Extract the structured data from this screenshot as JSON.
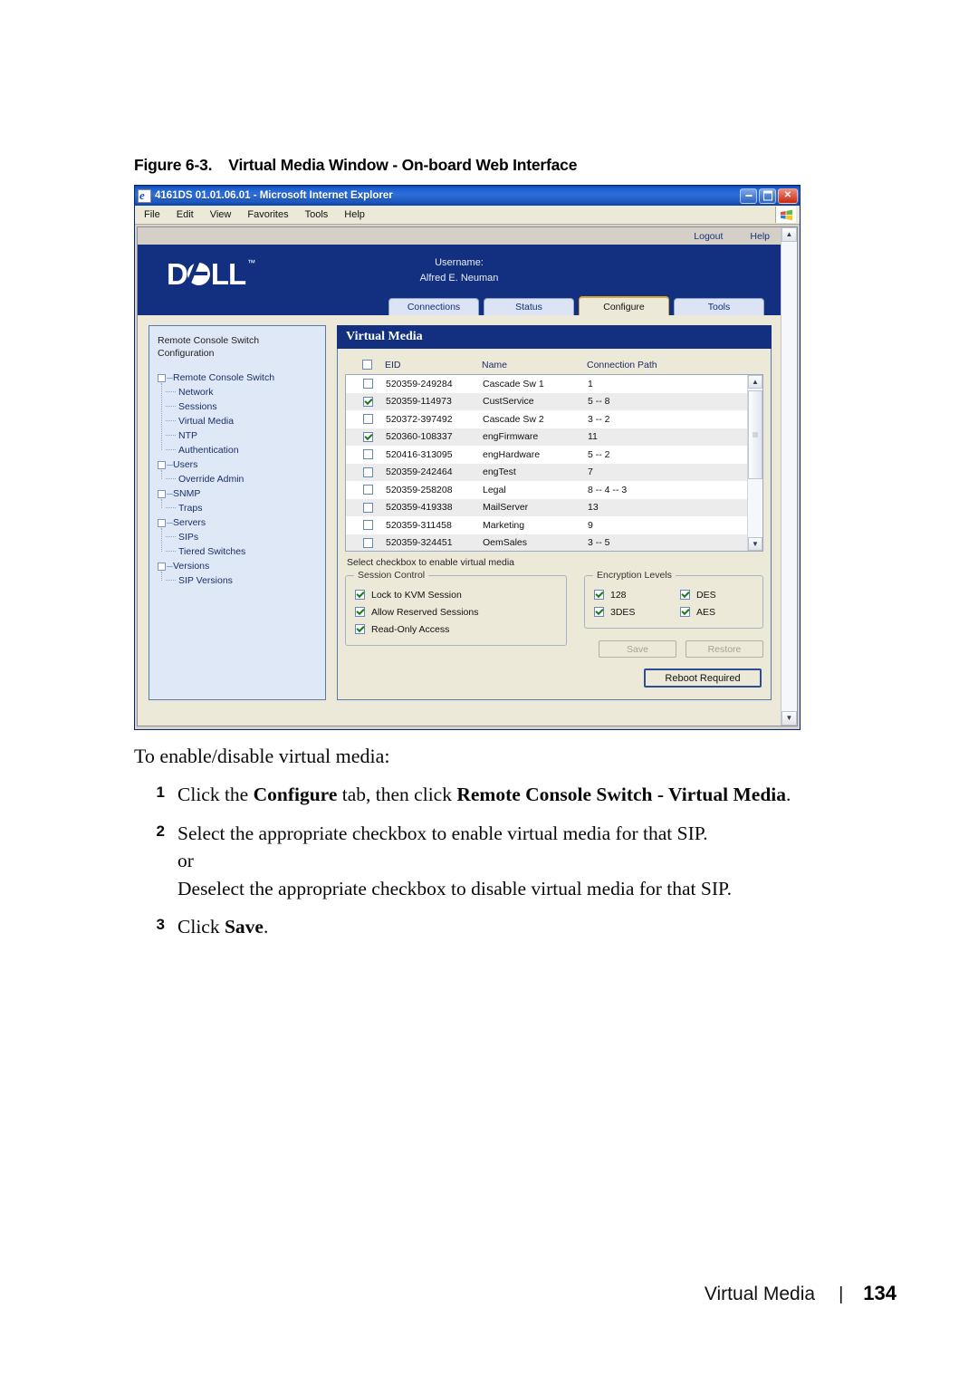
{
  "figure": {
    "number": "Figure 6-3.",
    "caption": "Virtual Media Window - On-board Web Interface"
  },
  "browser": {
    "title": "4161DS 01.01.06.01 - Microsoft Internet Explorer",
    "menus": [
      "File",
      "Edit",
      "View",
      "Favorites",
      "Tools",
      "Help"
    ],
    "window_buttons": [
      "minimize",
      "maximize",
      "close"
    ]
  },
  "app": {
    "util_links": [
      "Logout",
      "Help"
    ],
    "logo": "DELL",
    "logo_tm": "™",
    "username_label": "Username:",
    "username": "Alfred E. Neuman",
    "tabs": [
      {
        "label": "Connections",
        "active": false
      },
      {
        "label": "Status",
        "active": false
      },
      {
        "label": "Configure",
        "active": true
      },
      {
        "label": "Tools",
        "active": false
      }
    ]
  },
  "sidebar": {
    "title": "Remote Console Switch Configuration",
    "tree": [
      {
        "label": "Remote Console Switch",
        "children": [
          "Network",
          "Sessions",
          "Virtual Media",
          "NTP",
          "Authentication"
        ]
      },
      {
        "label": "Users",
        "children": [
          "Override Admin"
        ]
      },
      {
        "label": "SNMP",
        "children": [
          "Traps"
        ]
      },
      {
        "label": "Servers",
        "children": [
          "SIPs",
          "Tiered Switches"
        ]
      },
      {
        "label": "Versions",
        "children": [
          "SIP Versions"
        ]
      }
    ]
  },
  "panel": {
    "header": "Virtual Media",
    "table": {
      "select_all_checked": false,
      "columns": [
        "EID",
        "Name",
        "Connection Path"
      ],
      "rows": [
        {
          "checked": false,
          "eid": "520359-249284",
          "name": "Cascade Sw 1",
          "path": "1"
        },
        {
          "checked": true,
          "eid": "520359-114973",
          "name": "CustService",
          "path": "5 -- 8"
        },
        {
          "checked": false,
          "eid": "520372-397492",
          "name": "Cascade Sw 2",
          "path": "3 -- 2"
        },
        {
          "checked": true,
          "eid": "520360-108337",
          "name": "engFirmware",
          "path": "11"
        },
        {
          "checked": false,
          "eid": "520416-313095",
          "name": "engHardware",
          "path": "5 -- 2"
        },
        {
          "checked": false,
          "eid": "520359-242464",
          "name": "engTest",
          "path": "7"
        },
        {
          "checked": false,
          "eid": "520359-258208",
          "name": "Legal",
          "path": "8 -- 4 -- 3"
        },
        {
          "checked": false,
          "eid": "520359-419338",
          "name": "MailServer",
          "path": "13"
        },
        {
          "checked": false,
          "eid": "520359-311458",
          "name": "Marketing",
          "path": "9"
        },
        {
          "checked": false,
          "eid": "520359-324451",
          "name": "OemSales",
          "path": "3 -- 5"
        }
      ]
    },
    "hint": "Select checkbox to enable virtual media",
    "session_control": {
      "legend": "Session Control",
      "options": [
        {
          "label": "Lock to KVM Session",
          "checked": true
        },
        {
          "label": "Allow Reserved Sessions",
          "checked": true
        },
        {
          "label": "Read-Only Access",
          "checked": true
        }
      ]
    },
    "encryption_levels": {
      "legend": "Encryption Levels",
      "options": [
        {
          "label": "128",
          "checked": true
        },
        {
          "label": "DES",
          "checked": true
        },
        {
          "label": "3DES",
          "checked": true
        },
        {
          "label": "AES",
          "checked": true
        }
      ]
    },
    "buttons": {
      "save": "Save",
      "restore": "Restore",
      "reboot": "Reboot Required"
    }
  },
  "prose": {
    "lead": "To enable/disable virtual media:",
    "steps": [
      {
        "num": "1",
        "parts": [
          {
            "text": "Click the ",
            "bold": false
          },
          {
            "text": "Configure",
            "bold": true
          },
          {
            "text": " tab, then click ",
            "bold": false
          },
          {
            "text": "Remote Console Switch - Virtual Media",
            "bold": true
          },
          {
            "text": ".",
            "bold": false
          }
        ]
      },
      {
        "num": "2",
        "lines": [
          "Select the appropriate checkbox to enable virtual media for that SIP.",
          "or",
          "Deselect the appropriate checkbox to disable virtual media for that SIP."
        ]
      },
      {
        "num": "3",
        "parts": [
          {
            "text": "Click ",
            "bold": false
          },
          {
            "text": "Save",
            "bold": true
          },
          {
            "text": ".",
            "bold": false
          }
        ]
      }
    ]
  },
  "footer": {
    "section": "Virtual Media",
    "separator": "|",
    "page": "134"
  },
  "colors": {
    "dell_blue": "#12307f",
    "panel_bg": "#ece9d8",
    "sidebar_bg": "#dfe8f7",
    "check_green": "#187a18",
    "tab_active_border": "#d8a93a"
  }
}
